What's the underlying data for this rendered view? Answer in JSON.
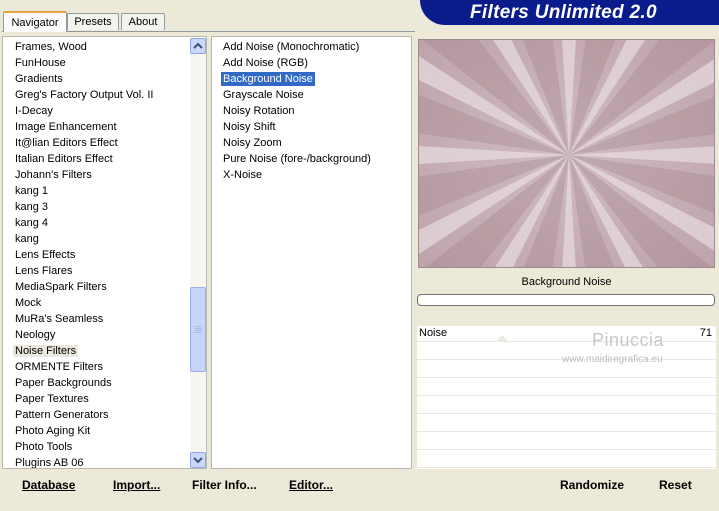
{
  "tabs": [
    {
      "label": "Navigator",
      "active": true
    },
    {
      "label": "Presets",
      "active": false
    },
    {
      "label": "About",
      "active": false
    }
  ],
  "header": {
    "title": "Filters Unlimited 2.0",
    "banner_color": "#0a1c8c"
  },
  "categories": [
    "Frames, Wood",
    "FunHouse",
    "Gradients",
    "Greg's Factory Output Vol. II",
    "I-Decay",
    "Image Enhancement",
    "It@lian Editors Effect",
    "Italian Editors Effect",
    "Johann's Filters",
    "kang 1",
    "kang 3",
    "kang 4",
    "kang",
    "Lens Effects",
    "Lens Flares",
    "MediaSpark Filters",
    "Mock",
    "MuRa's Seamless",
    "Neology",
    "Noise Filters",
    "ORMENTE Filters",
    "Paper Backgrounds",
    "Paper Textures",
    "Pattern Generators",
    "Photo Aging Kit",
    "Photo Tools",
    "Plugins AB 06"
  ],
  "selected_category": "Noise Filters",
  "filters": [
    "Add Noise (Monochromatic)",
    "Add Noise (RGB)",
    "Background Noise",
    "Grayscale Noise",
    "Noisy Rotation",
    "Noisy Shift",
    "Noisy Zoom",
    "Pure Noise (fore-/background)",
    "X-Noise"
  ],
  "selected_filter": "Background Noise",
  "preview": {
    "caption": "Background Noise"
  },
  "params": [
    {
      "label": "Noise",
      "value": "71"
    }
  ],
  "watermark": {
    "name": "Pinuccia",
    "site": "www.maidiregrafica.eu"
  },
  "buttons": {
    "database": "Database",
    "import": "Import...",
    "filter_info": "Filter Info...",
    "editor": "Editor...",
    "randomize": "Randomize",
    "reset": "Reset"
  },
  "colors": {
    "selection": "#316ac5",
    "accent_tab": "#e8a33d",
    "preview_tint": "#cdb5bb"
  }
}
